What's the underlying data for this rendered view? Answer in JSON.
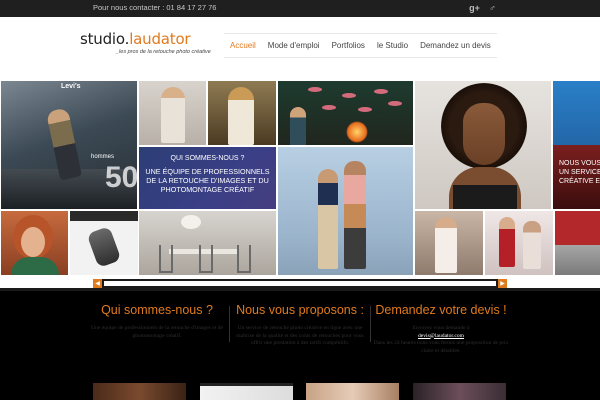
{
  "topbar": {
    "contact": "Pour nous contacter : 01 84 17 27 76",
    "icons": [
      "google-plus-icon",
      "male-symbol-icon"
    ]
  },
  "logo": {
    "part1": "studio",
    "dot": ".",
    "part2": "laudator",
    "tagline": "_les pros de la retouche photo créative"
  },
  "nav": {
    "items": [
      "Accueil",
      "Mode d'emploi",
      "Portfolios",
      "le Studio",
      "Demandez un devis"
    ],
    "active_index": 0
  },
  "mosaic": {
    "tile1_brand": "Levi's",
    "tile1_caption": "hommes",
    "tile1_number": "50",
    "panel_heading": "QUI SOMMES-NOUS ?",
    "panel_text": "UNE ÉQUIPE DE PROFESSIONNELS DE LA RETOUCHE D'IMAGES ET DU PHOTOMONTAGE CRÉATIF",
    "right_panel_text_1": "NOUS VOUS",
    "right_panel_text_2": "UN SERVICE",
    "right_panel_text_3": "CRÉATIVE ET"
  },
  "scroller": {
    "left_arrow": "◀",
    "right_arrow": "▶"
  },
  "sections": [
    {
      "title": "Qui sommes-nous ?",
      "text": "Une équipe de professionnels de la retouche d'images et de photomontage créatif."
    },
    {
      "title": "Nous vous proposons :",
      "text": "Un service de retouche photo créative en ligne avec une maîtrise de la qualité et des coûts de retouches pour vous offrir une prestation à des tarifs compétitifs."
    },
    {
      "title": "Demandez votre devis !",
      "text_before": "Envoyez vous demande à",
      "link": "devis@laudator.com",
      "text_after": "Dans les 24 heures nous vous ferons une proposition de prix claire et détaillée."
    }
  ],
  "colors": {
    "accent": "#e07a1f",
    "topbar": "#1f1f1f",
    "dark": "#000000",
    "panel_blue": "#3a3f86"
  }
}
